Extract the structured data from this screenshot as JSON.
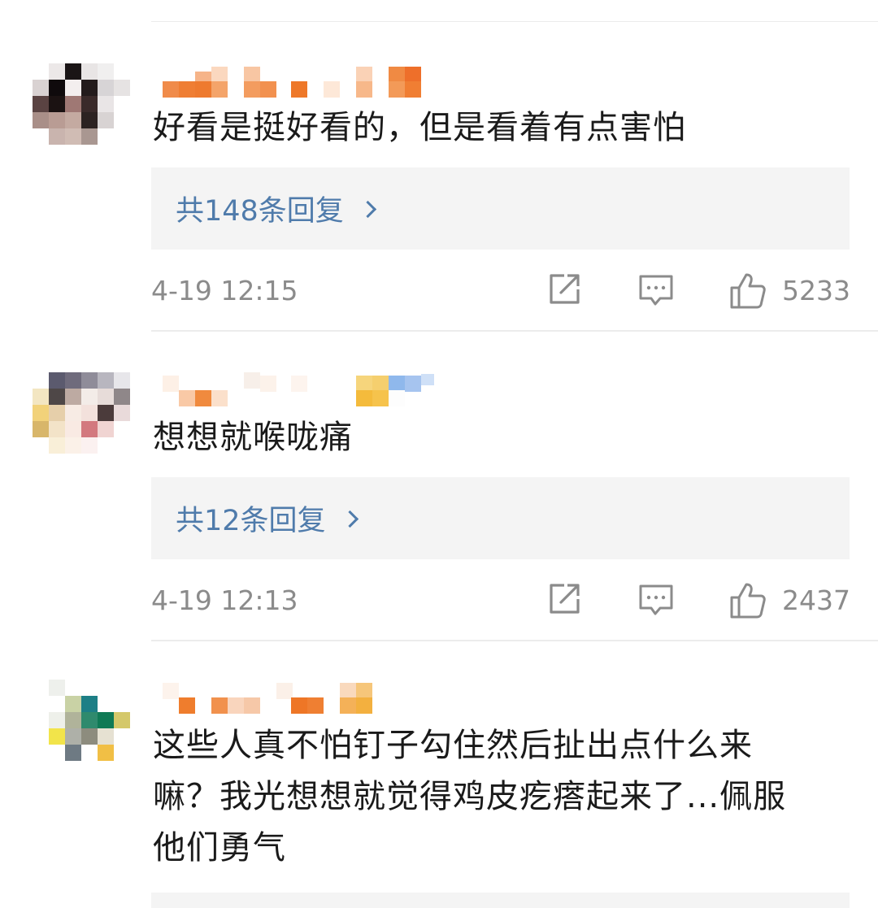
{
  "comments": [
    {
      "text": "好看是挺好看的，但是看着有点害怕",
      "replies_label": "共148条回复",
      "timestamp": "4-19 12:15",
      "likes": "5233"
    },
    {
      "text": "想想就喉咙痛",
      "replies_label": "共12条回复",
      "timestamp": "4-19 12:13",
      "likes": "2437"
    },
    {
      "text": "这些人真不怕钉子勾住然后扯出点什么来\n嘛？我光想想就觉得鸡皮疙瘩起来了...佩服\n他们勇气"
    }
  ],
  "icons": {
    "share": "share-icon",
    "comment": "comment-icon",
    "like": "thumbs-up-icon"
  },
  "colors": {
    "reply_link": "#4f7bab",
    "reply_bg": "#f4f4f4",
    "meta_text": "#8b8b8b",
    "body_text": "#1a1a1a",
    "divider": "#ececec"
  }
}
